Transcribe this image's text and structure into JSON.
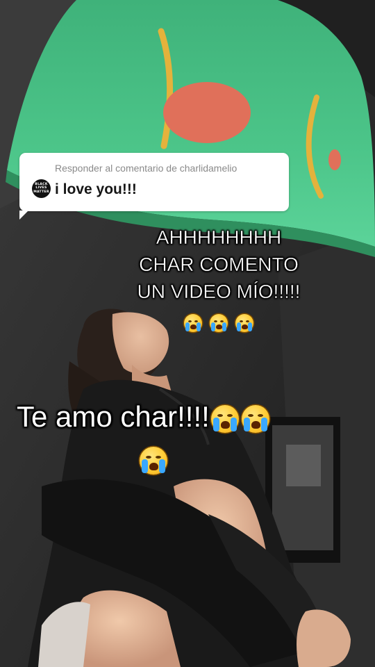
{
  "reply": {
    "header": "Responder al comentario de charlidamelio",
    "comment": "i love you!!!",
    "avatar_icon": "black-lives-matter-avatar-icon",
    "avatar_text": [
      "BLACK",
      "LIVES",
      "MATTER"
    ]
  },
  "caption_top": {
    "lines": [
      "AHHHHHHHH",
      "CHAR COMENTO",
      "UN VIDEO MÍO!!!!!"
    ],
    "emoji_icons": [
      "loudly-crying-face-icon",
      "loudly-crying-face-icon",
      "loudly-crying-face-icon"
    ]
  },
  "caption_main": {
    "text": "Te amo char!!!!",
    "emoji_icons": [
      "loudly-crying-face-icon",
      "loudly-crying-face-icon",
      "loudly-crying-face-icon"
    ]
  },
  "colors": {
    "lamp_green": "#4bc386",
    "lamp_dot": "#e0705a",
    "lamp_stroke": "#e8b040",
    "sweatshirt": "#1a1a1a",
    "background_dark": "#262626",
    "bubble_bg": "#ffffff"
  }
}
